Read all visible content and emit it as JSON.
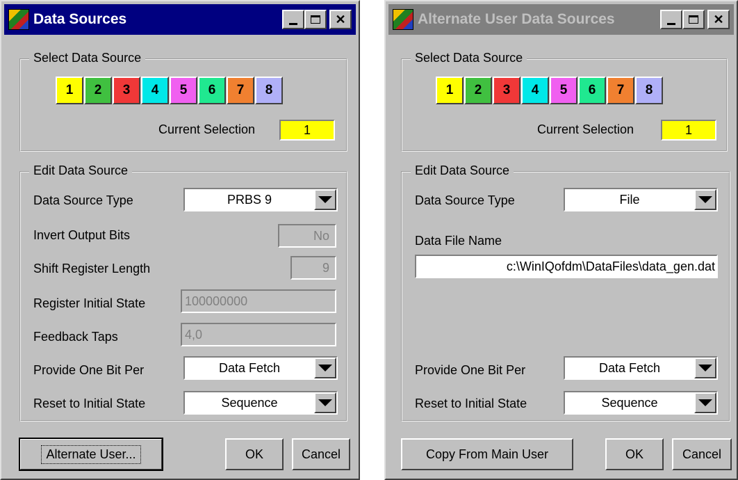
{
  "main_dialog": {
    "title": "Data Sources",
    "select_group": "Select Data Source",
    "sources": [
      {
        "label": "1",
        "color": "#ffff00"
      },
      {
        "label": "2",
        "color": "#40c040"
      },
      {
        "label": "3",
        "color": "#f03838"
      },
      {
        "label": "4",
        "color": "#00e8e8"
      },
      {
        "label": "5",
        "color": "#f060f0"
      },
      {
        "label": "6",
        "color": "#20e890"
      },
      {
        "label": "7",
        "color": "#f08030"
      },
      {
        "label": "8",
        "color": "#b0b0f8"
      }
    ],
    "current_selection_label": "Current Selection",
    "current_selection_value": "1",
    "selection_color": "#ffff00",
    "edit_group": "Edit Data Source",
    "data_source_type_label": "Data Source Type",
    "data_source_type_value": "PRBS 9",
    "invert_label": "Invert Output Bits",
    "invert_value": "No",
    "shift_label": "Shift Register Length",
    "shift_value": "9",
    "initial_state_label": "Register Initial State",
    "initial_state_value": "100000000",
    "feedback_label": "Feedback Taps",
    "feedback_value": "4,0",
    "provide_label": "Provide One Bit Per",
    "provide_value": "Data Fetch",
    "reset_label": "Reset to Initial State",
    "reset_value": "Sequence",
    "alt_button": "Alternate User...",
    "ok_button": "OK",
    "cancel_button": "Cancel"
  },
  "alt_dialog": {
    "title": "Alternate User Data Sources",
    "select_group": "Select Data Source",
    "current_selection_label": "Current Selection",
    "current_selection_value": "1",
    "edit_group": "Edit Data Source",
    "data_source_type_label": "Data Source Type",
    "data_source_type_value": "File",
    "file_label": "Data File Name",
    "file_value": "c:\\WinIQofdm\\DataFiles\\data_gen.dat",
    "provide_label": "Provide One Bit Per",
    "provide_value": "Data Fetch",
    "reset_label": "Reset to Initial State",
    "reset_value": "Sequence",
    "copy_button": "Copy From Main User",
    "ok_button": "OK",
    "cancel_button": "Cancel"
  },
  "icons": {
    "app": "app-logo-icon",
    "minimize": "minimize-icon",
    "maximize": "maximize-icon",
    "close": "close-icon",
    "dropdown": "chevron-down-icon"
  }
}
